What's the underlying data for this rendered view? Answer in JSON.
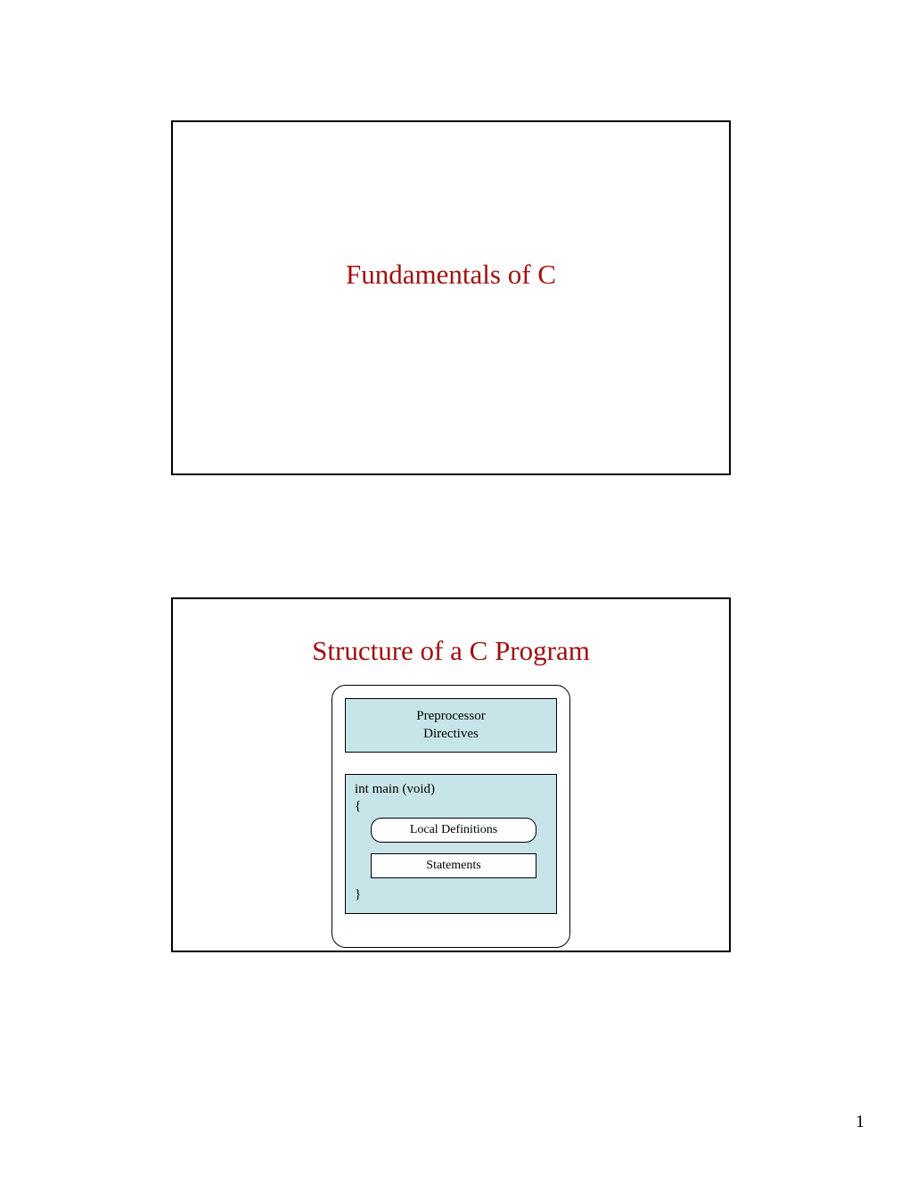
{
  "slide1": {
    "title": "Fundamentals of C"
  },
  "slide2": {
    "title": "Structure of a C Program",
    "preprocessor_line1": "Preprocessor",
    "preprocessor_line2": "Directives",
    "main_signature": "int main (void)",
    "open_brace": "{",
    "local_def": "Local Definitions",
    "statements": "Statements",
    "close_brace": "}"
  },
  "page_number": "1"
}
